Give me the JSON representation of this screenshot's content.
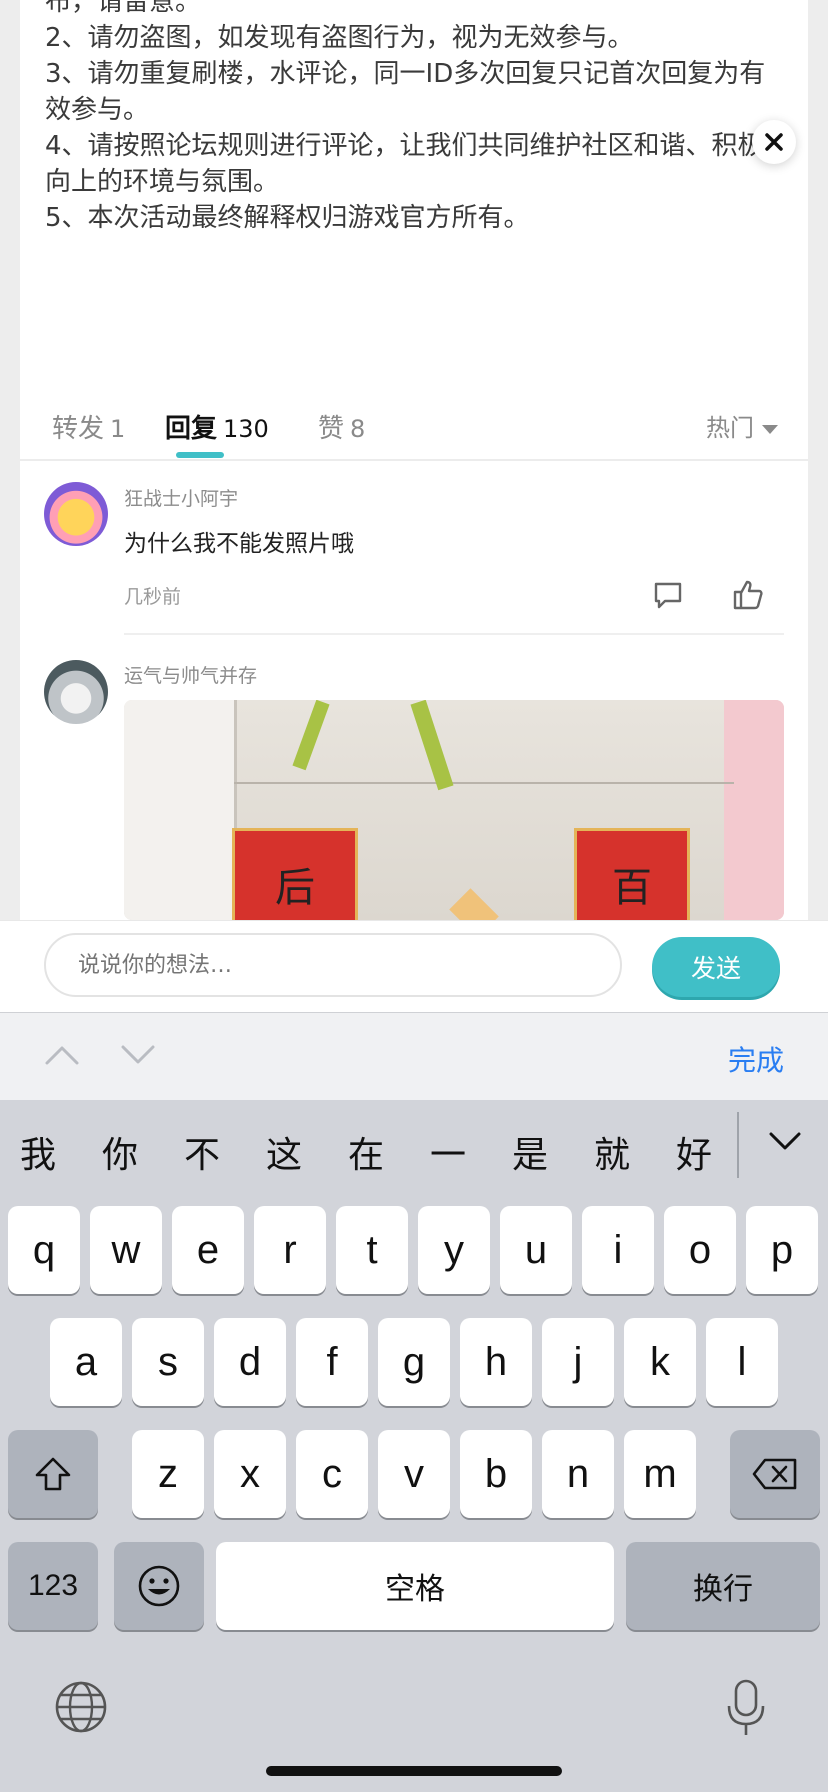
{
  "rules": {
    "partial_line": "布，请留意。",
    "lines": [
      "2、请勿盗图，如发现有盗图行为，视为无效参与。",
      "3、请勿重复刷楼，水评论，同一ID多次回复只记首次回复为有",
      "效参与。",
      "4、请按照论坛规则进行评论，让我们共同维护社区和谐、积极",
      "向上的环境与氛围。",
      "5、本次活动最终解释权归游戏官方所有。"
    ]
  },
  "close_icon": "close-icon",
  "tabs": [
    {
      "label": "转发",
      "count": "1",
      "active": false
    },
    {
      "label": "回复",
      "count": "130",
      "active": true
    },
    {
      "label": "赞",
      "count": "8",
      "active": false
    }
  ],
  "sort": {
    "label": "热门",
    "icon": "caret-down-icon"
  },
  "comments": [
    {
      "username": "狂战士小阿宇",
      "text": "为什么我不能发照片哦",
      "time": "几秒前"
    },
    {
      "username": "运气与帅气并存",
      "photo_chars": [
        "后",
        "百"
      ]
    }
  ],
  "input": {
    "placeholder": "说说你的想法…",
    "send_label": "发送"
  },
  "accessory": {
    "done_label": "完成"
  },
  "keyboard": {
    "candidates": [
      "我",
      "你",
      "不",
      "这",
      "在",
      "一",
      "是",
      "就",
      "好"
    ],
    "row1": [
      "q",
      "w",
      "e",
      "r",
      "t",
      "y",
      "u",
      "i",
      "o",
      "p"
    ],
    "row2": [
      "a",
      "s",
      "d",
      "f",
      "g",
      "h",
      "j",
      "k",
      "l"
    ],
    "row3": [
      "z",
      "x",
      "c",
      "v",
      "b",
      "n",
      "m"
    ],
    "num_label": "123",
    "space_label": "空格",
    "return_label": "换行"
  },
  "colors": {
    "accent": "#40bfc7",
    "done": "#2a7ef2",
    "keyboard_bg": "#d2d4da"
  }
}
